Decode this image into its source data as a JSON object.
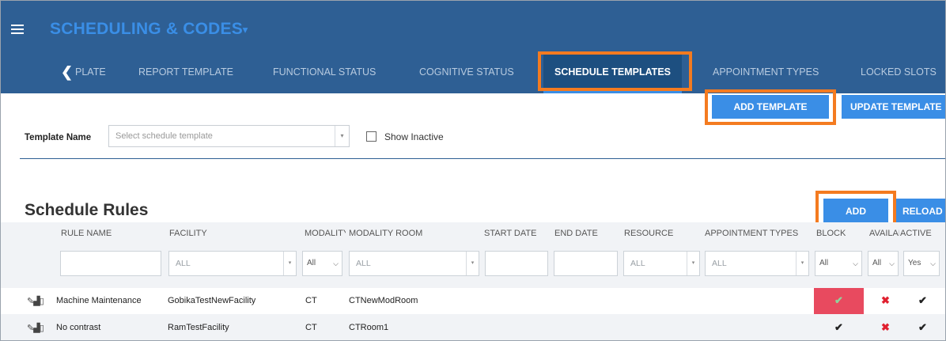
{
  "app": {
    "title": "SCHEDULING & CODES",
    "title_caret": "▾"
  },
  "tabs": [
    {
      "label": "PLATE"
    },
    {
      "label": "REPORT TEMPLATE"
    },
    {
      "label": "FUNCTIONAL STATUS"
    },
    {
      "label": "COGNITIVE STATUS"
    },
    {
      "label": "SCHEDULE TEMPLATES",
      "active": true
    },
    {
      "label": "APPOINTMENT TYPES"
    },
    {
      "label": "LOCKED SLOTS"
    }
  ],
  "actions": {
    "add_template": "ADD TEMPLATE",
    "update_template": "UPDATE TEMPLATE"
  },
  "template": {
    "label": "Template Name",
    "placeholder": "Select schedule template",
    "show_inactive_label": "Show Inactive",
    "show_inactive_checked": false
  },
  "section": {
    "title": "Schedule Rules",
    "add": "ADD",
    "reload": "RELOAD"
  },
  "grid": {
    "columns": [
      "RULE NAME",
      "FACILITY",
      "MODALITY",
      "MODALITY ROOM",
      "START DATE",
      "END DATE",
      "RESOURCE",
      "APPOINTMENT TYPES",
      "BLOCK",
      "AVAILABLE",
      "ACTIVE"
    ],
    "filters": {
      "facility": "ALL",
      "modality": "All",
      "modality_room": "ALL",
      "resource": "ALL",
      "appointment_types": "ALL",
      "block": "All",
      "available": "All",
      "active": "Yes"
    },
    "rows": [
      {
        "rule_name": "Machine Maintenance",
        "facility": "GobikaTestNewFacility",
        "modality": "CT",
        "modality_room": "CTNewModRoom",
        "block": true,
        "available": false,
        "active": true
      },
      {
        "rule_name": "No contrast",
        "facility": "RamTestFacility",
        "modality": "CT",
        "modality_room": "CTRoom1",
        "block": true,
        "available": false,
        "active": true
      }
    ]
  },
  "colors": {
    "header": "#2e5f94",
    "accent": "#3a8ee6",
    "highlight": "#f47b20",
    "block_red": "#e84a5f"
  }
}
